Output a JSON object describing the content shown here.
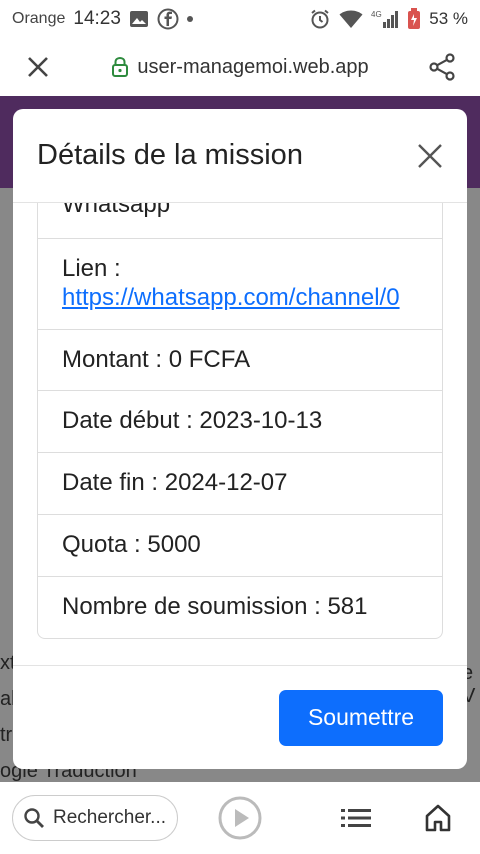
{
  "status_bar": {
    "carrier": "Orange",
    "time": "14:23",
    "network": "4G",
    "battery": "53 %"
  },
  "browser": {
    "url": "user-managemoi.web.app"
  },
  "background_text": {
    "line1_left": "xt",
    "line2_left": "alu",
    "line3_left": "tre",
    "line4": "ogle Traduction",
    "right": "e V"
  },
  "modal": {
    "title": "Détails de la mission",
    "items": [
      {
        "label": "Whatsapp"
      },
      {
        "label": "Lien :",
        "link": "https://whatsapp.com/channel/0"
      },
      {
        "label": "Montant : 0 FCFA"
      },
      {
        "label": "Date début : 2023-10-13"
      },
      {
        "label": "Date fin : 2024-12-07"
      },
      {
        "label": "Quota : 5000"
      },
      {
        "label": "Nombre de soumission : 581"
      }
    ],
    "submit_label": "Soumettre"
  },
  "bottom_nav": {
    "search_placeholder": "Rechercher..."
  }
}
